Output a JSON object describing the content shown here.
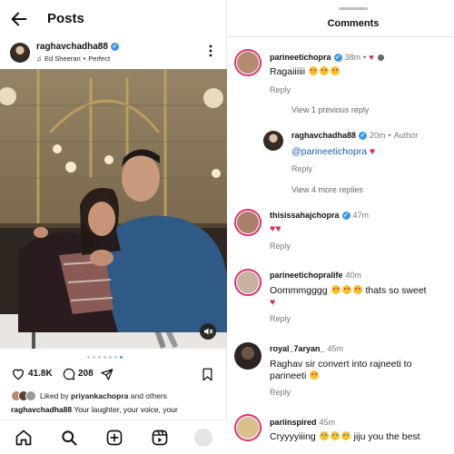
{
  "header": {
    "page_title": "Posts"
  },
  "post": {
    "username": "raghavchadha88",
    "music_artist": "Ed Sheeran",
    "music_separator": "•",
    "music_track": "Perfect",
    "like_count": "41.8K",
    "comment_count": "208",
    "liked_by_prefix": "Liked by",
    "liked_by_user": "priyankachopra",
    "liked_by_suffix": "and others",
    "caption_user": "raghavchadha88",
    "caption_text": "Your laughter, your voice, your",
    "carousel_count": 7,
    "carousel_active": 6
  },
  "comments_panel": {
    "title": "Comments",
    "comments": [
      {
        "user": "parineetichopra",
        "verified": true,
        "time": "38m",
        "text": "Ragaiiiiii",
        "reply": "Reply"
      },
      {
        "view_previous": "View 1 previous reply"
      },
      {
        "user": "raghavchadha88",
        "verified": true,
        "time": "20m",
        "author_label": "Author",
        "mention": "@parineetichopra",
        "reply": "Reply"
      },
      {
        "view_more": "View 4 more replies"
      },
      {
        "user": "thisissahajchopra",
        "verified": true,
        "time": "47m",
        "reply": "Reply"
      },
      {
        "user": "parineetichopralife",
        "verified": false,
        "time": "40m",
        "text_a": "Oommmgggg",
        "text_b": "thats so sweet",
        "reply": "Reply"
      },
      {
        "user": "royal_7aryan_",
        "verified": false,
        "time": "45m",
        "text": "Raghav sir convert into rajneeti to parineeti",
        "reply": "Reply"
      },
      {
        "user": "pariinspired",
        "verified": false,
        "time": "45m",
        "text_a": "Cryyyyiiing",
        "text_b": "jiju you the best"
      }
    ]
  },
  "colors": {
    "accent": "#3897f0",
    "heart": "#e0245e",
    "mention": "#1a5dab"
  },
  "icons": {
    "back": "arrow-left-icon",
    "more": "more-vertical-icon",
    "like": "heart-icon",
    "comment": "comment-icon",
    "share": "send-icon",
    "save": "bookmark-icon",
    "mute": "speaker-muted-icon",
    "nav": [
      "home-icon",
      "search-icon",
      "create-icon",
      "reels-icon",
      "profile-icon"
    ]
  }
}
